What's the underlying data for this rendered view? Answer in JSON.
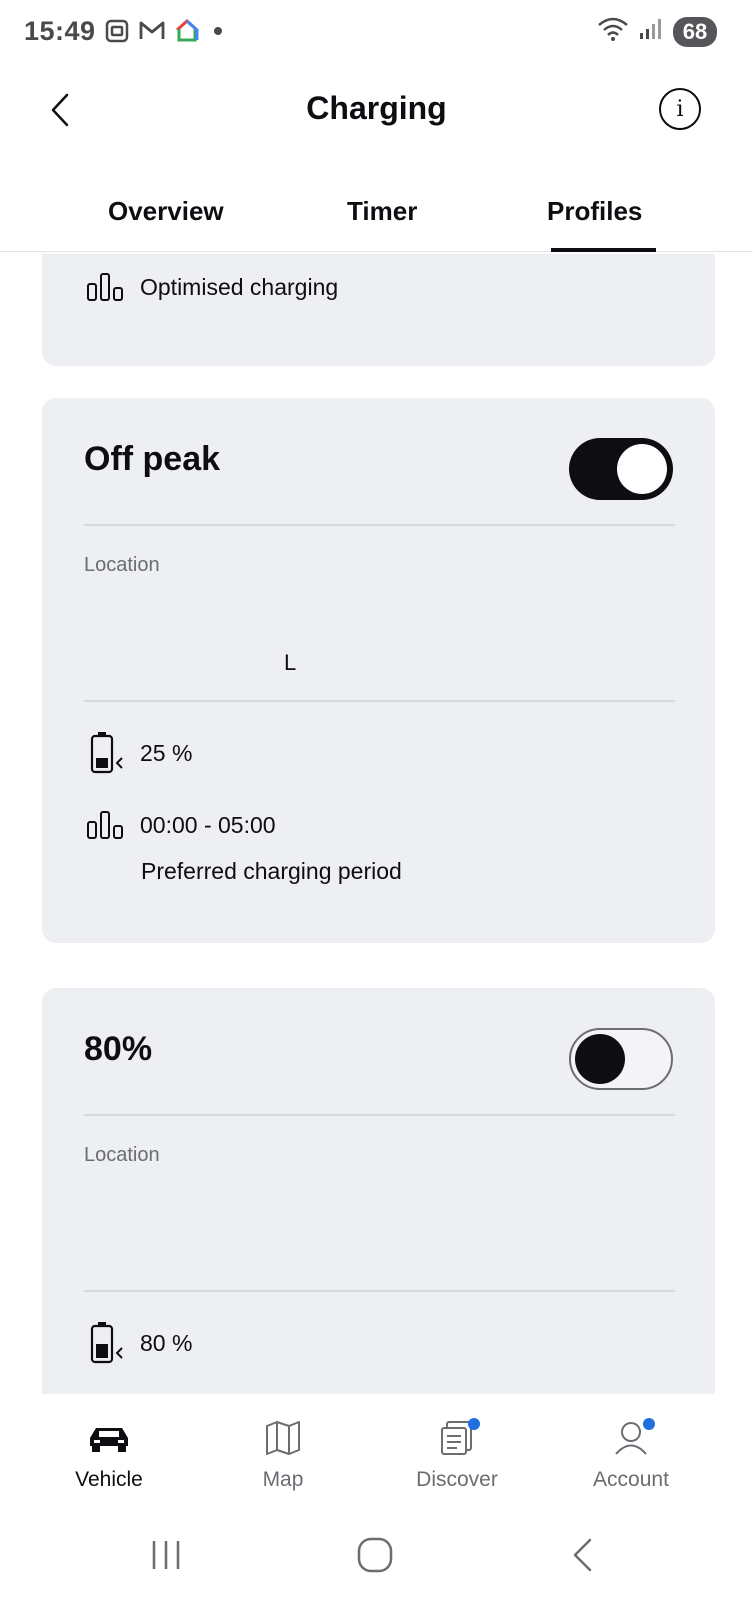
{
  "status_bar": {
    "time": "15:49",
    "battery": "68",
    "left_icons": [
      "screenshot-icon",
      "gmail-icon",
      "google-home-icon",
      "dot-icon"
    ],
    "right_icons": [
      "wifi-icon",
      "signal-icon"
    ]
  },
  "header": {
    "title": "Charging",
    "back_icon": "chevron-left-icon",
    "info_label": "i"
  },
  "tabs": [
    {
      "label": "Overview",
      "active": false
    },
    {
      "label": "Timer",
      "active": false
    },
    {
      "label": "Profiles",
      "active": true
    }
  ],
  "cards": {
    "top": {
      "mode_text": "Optimised charging"
    },
    "off_peak": {
      "title": "Off peak",
      "enabled": true,
      "location_label": "Location",
      "location_value": "L",
      "min_charge": "25 %",
      "period": "00:00 - 05:00",
      "period_label": "Preferred charging period"
    },
    "p80": {
      "title": "80%",
      "enabled": false,
      "location_label": "Location",
      "min_charge": "80 %"
    }
  },
  "bottom_nav": [
    {
      "label": "Vehicle",
      "icon": "car-icon",
      "active": true,
      "badge": false
    },
    {
      "label": "Map",
      "icon": "map-icon",
      "active": false,
      "badge": false
    },
    {
      "label": "Discover",
      "icon": "news-icon",
      "active": false,
      "badge": true
    },
    {
      "label": "Account",
      "icon": "person-icon",
      "active": false,
      "badge": true
    }
  ],
  "colors": {
    "card_bg": "#eeeff2",
    "text": "#0e0e12",
    "muted": "#6b6d72",
    "badge": "#1f6fe0"
  }
}
